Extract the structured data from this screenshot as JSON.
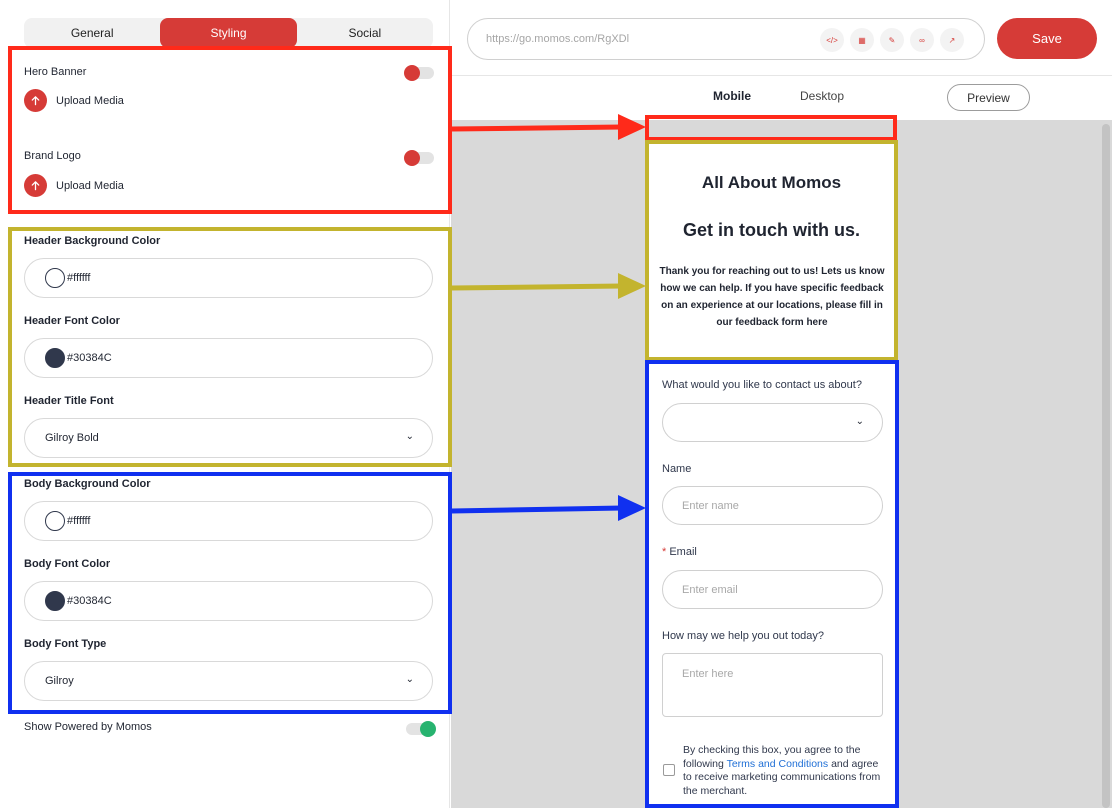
{
  "tabs": [
    "General",
    "Styling",
    "Social"
  ],
  "active_tab": "Styling",
  "hero": {
    "label": "Hero Banner",
    "upload": "Upload Media"
  },
  "brand": {
    "label": "Brand Logo",
    "upload": "Upload Media"
  },
  "header_bg": {
    "label": "Header Background Color",
    "value": "#ffffff"
  },
  "header_font": {
    "label": "Header Font Color",
    "value": "#30384C"
  },
  "header_title_font": {
    "label": "Header Title Font",
    "value": "Gilroy Bold"
  },
  "body_bg": {
    "label": "Body Background Color",
    "value": "#ffffff"
  },
  "body_font": {
    "label": "Body Font Color",
    "value": "#30384C"
  },
  "body_font_type": {
    "label": "Body Font Type",
    "value": "Gilroy"
  },
  "powered_by": {
    "label": "Show Powered by Momos",
    "enabled": true
  },
  "url": {
    "value": "https://go.momos.com/RgXDl"
  },
  "url_icons": [
    "embed-icon",
    "qr-icon",
    "edit-icon",
    "link-icon",
    "open-external-icon"
  ],
  "save_label": "Save",
  "view_tabs": [
    "Mobile",
    "Desktop"
  ],
  "active_view": "Mobile",
  "preview_label": "Preview",
  "preview": {
    "header_title": "All About Momos",
    "header_subtitle": "Get in touch with us.",
    "header_text": "Thank you for reaching out to us! Lets us know how we can help. If you have specific feedback on an experience at our locations, please fill in our feedback form here",
    "q_contact": "What would you like to contact us about?",
    "name_label": "Name",
    "name_placeholder": "Enter name",
    "email_required": "*",
    "email_label": "Email",
    "email_placeholder": "Enter email",
    "help_label": "How may we help you out today?",
    "help_placeholder": "Enter here",
    "consent_pre": "By checking this box, you agree to the following ",
    "consent_link": "Terms and Conditions",
    "consent_post": " and agree to receive marketing communications from the merchant."
  },
  "colors": {
    "accent": "#d63b37",
    "header_font": "#30384C",
    "toggle_on": "#27b36f",
    "box_red": "#ff2a1a",
    "box_olive": "#c3b42e",
    "box_blue": "#1030f0"
  }
}
